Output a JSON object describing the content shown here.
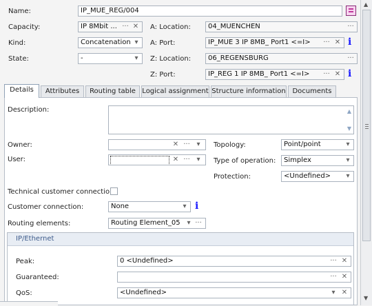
{
  "header": {
    "name": {
      "label": "Name:",
      "value": "IP_MUE_REG/004"
    },
    "capacity": {
      "label": "Capacity:",
      "value": "IP 8Mbit ..."
    },
    "kind": {
      "label": "Kind:",
      "value": "Concatenation"
    },
    "state": {
      "label": "State:",
      "value": "-"
    },
    "a_location": {
      "label": "A: Location:",
      "value": "04_MUENCHEN"
    },
    "a_port": {
      "label": "A: Port:",
      "value": "IP_MUE 3 IP 8MB_ Port1 <=I>"
    },
    "z_location": {
      "label": "Z: Location:",
      "value": "06_REGENSBURG"
    },
    "z_port": {
      "label": "Z: Port:",
      "value": "IP_REG 1 IP 8MB_ Port1 <=I>"
    }
  },
  "tabs": [
    "Details",
    "Attributes",
    "Routing table",
    "Logical assignment",
    "Structure information",
    "Documents"
  ],
  "details": {
    "description": {
      "label": "Description:",
      "value": ""
    },
    "owner": {
      "label": "Owner:",
      "value": ""
    },
    "user": {
      "label": "User:",
      "value": ""
    },
    "topology": {
      "label": "Topology:",
      "value": "Point/point"
    },
    "type_of_operation": {
      "label": "Type of operation:",
      "value": "Simplex"
    },
    "protection": {
      "label": "Protection:",
      "value": "<Undefined>"
    },
    "technical_customer_connection": {
      "label": "Technical customer connection:",
      "checked": false
    },
    "customer_connection": {
      "label": "Customer connection:",
      "value": "None"
    },
    "routing_elements": {
      "label": "Routing elements:",
      "value": "Routing Element_05"
    }
  },
  "ip_ethernet": {
    "title": "IP/Ethernet",
    "peak": {
      "label": "Peak:",
      "value": "0 <Undefined>"
    },
    "guaranteed": {
      "label": "Guaranteed:",
      "value": ""
    },
    "qos": {
      "label": "QoS:",
      "value": "<Undefined>"
    }
  },
  "glyphs": {
    "dots": "···",
    "clear": "✕",
    "arrow": "▾",
    "info": "i",
    "up": "▲",
    "down": "▼"
  },
  "colors": {
    "accent": "#1a1aff",
    "border": "#a9b2bd",
    "name_icon": "#c0399c"
  }
}
